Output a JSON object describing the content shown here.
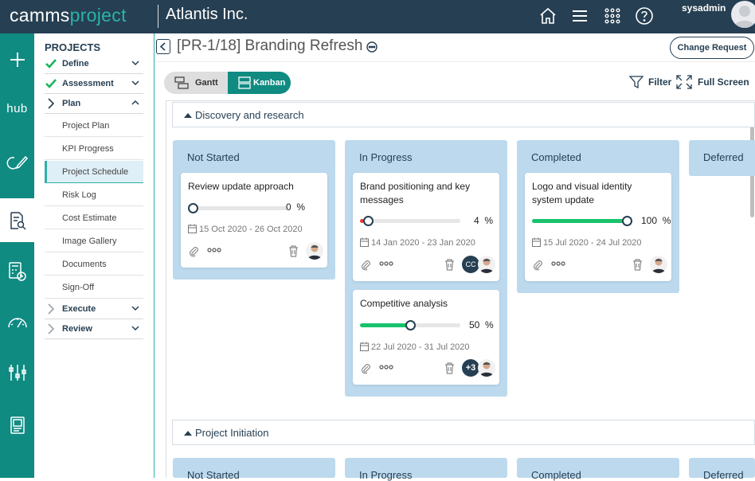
{
  "header": {
    "logo_part1": "camms",
    "logo_part2": "project",
    "company": "Atlantis Inc.",
    "user": "sysadmin",
    "icons": [
      "home-icon",
      "menu-icon",
      "apps-grid-icon",
      "help-icon"
    ]
  },
  "rail": {
    "items": [
      "add-icon",
      "hub-icon",
      "edit-icon",
      "document-search-icon",
      "calculator-clock-icon",
      "gauge-icon",
      "sliders-icon",
      "report-icon"
    ],
    "hub_label": "hub"
  },
  "nav": {
    "title": "PROJECTS",
    "sections": [
      {
        "label": "Define",
        "state": "done"
      },
      {
        "label": "Assessment",
        "state": "done"
      },
      {
        "label": "Plan",
        "state": "open"
      },
      {
        "label": "Execute",
        "state": "closed"
      },
      {
        "label": "Review",
        "state": "closed"
      }
    ],
    "plan_items": [
      "Project Plan",
      "KPI Progress",
      "Project Schedule",
      "Risk Log",
      "Cost Estimate",
      "Image Gallery",
      "Documents",
      "Sign-Off"
    ],
    "active_item": "Project Schedule"
  },
  "page": {
    "title": "[PR-1/18] Branding Refresh",
    "change_request": "Change Request",
    "view_gantt": "Gantt",
    "view_kanban": "Kanban",
    "filter": "Filter",
    "fullscreen": "Full Screen"
  },
  "groups": [
    {
      "name": "Discovery and research",
      "columns": [
        "Not Started",
        "In Progress",
        "Completed",
        "Deferred"
      ],
      "cards": [
        {
          "title": "Review update approach",
          "progress": 0,
          "pct": "0",
          "dates": "15 Oct 2020 - 26 Oct 2020",
          "status": "Not Started"
        },
        {
          "title": "Brand positioning and key messages",
          "progress": 4,
          "pct": "4",
          "dates": "14 Jan 2020 - 23 Jan 2020",
          "status": "In Progress",
          "initials": "CC"
        },
        {
          "title": "Competitive analysis",
          "progress": 50,
          "pct": "50",
          "dates": "22 Jul 2020 - 31 Jul 2020",
          "status": "In Progress",
          "more": "+3"
        },
        {
          "title": "Logo and visual identity system update",
          "progress": 100,
          "pct": "100",
          "dates": "15 Jul 2020 - 24 Jul 2020",
          "status": "Completed"
        }
      ]
    },
    {
      "name": "Project Initiation",
      "columns": [
        "Not Started",
        "In Progress",
        "Completed",
        "Deferred"
      ]
    }
  ],
  "pct_symbol": "%",
  "colors": {
    "topbar": "#263f52",
    "rail": "#0f8b82",
    "accent": "#2fb1a7",
    "column": "#bcd9ee",
    "progress": "#18c26b",
    "progress_low": "#e53935"
  }
}
